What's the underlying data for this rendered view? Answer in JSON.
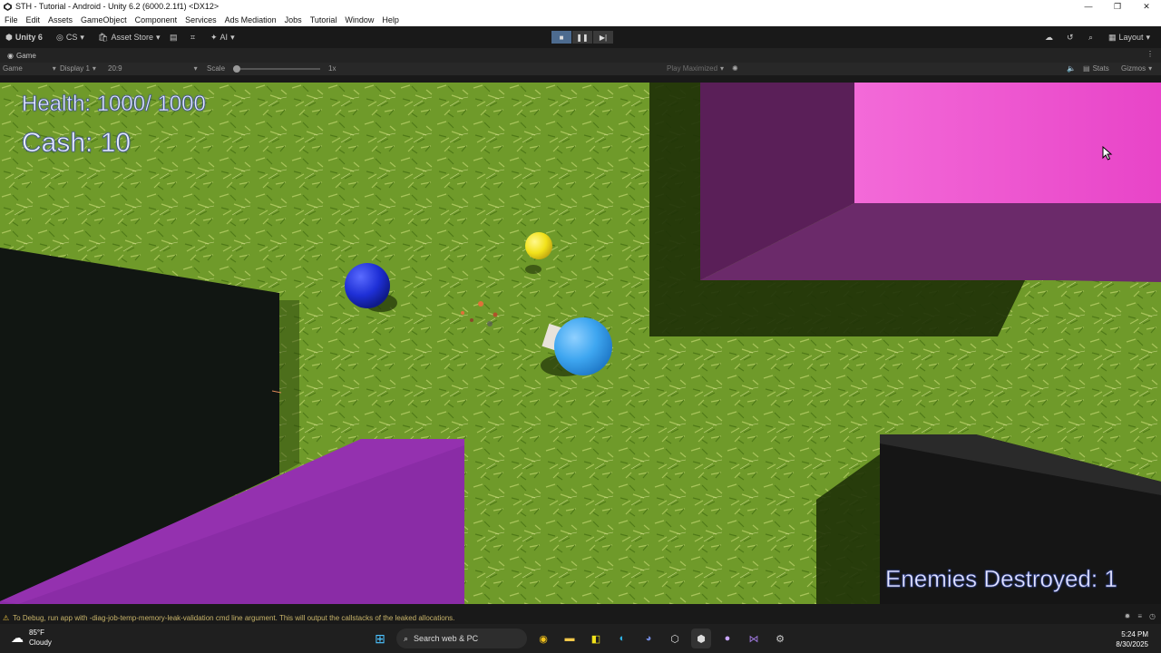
{
  "window": {
    "title": "STH - Tutorial - Android - Unity 6.2 (6000.2.1f1) <DX12>"
  },
  "menu": [
    "File",
    "Edit",
    "Assets",
    "GameObject",
    "Component",
    "Services",
    "Ads Mediation",
    "Jobs",
    "Tutorial",
    "Window",
    "Help"
  ],
  "toolbar": {
    "account": "Unity 6",
    "cs": "CS",
    "asset_store": "Asset Store",
    "ai": "AI",
    "layout": "Layout",
    "play_active_glyph": "■",
    "pause_glyph": "❚❚",
    "step_glyph": "▶|"
  },
  "tab": {
    "label": "Game"
  },
  "game_options": {
    "view": "Game",
    "display": "Display 1",
    "aspect": "20:9",
    "scale_label": "Scale",
    "scale_value": "1x",
    "play_mode": "Play Maximized",
    "stats": "Stats",
    "gizmos": "Gizmos"
  },
  "hud": {
    "health": "Health: 1000/ 1000",
    "cash": "Cash: 10",
    "enemies": "Enemies Destroyed: 1"
  },
  "console": {
    "message": "To Debug, run app with -diag-job-temp-memory-leak-validation cmd line argument. This will output the callstacks of the leaked allocations."
  },
  "taskbar": {
    "temp": "85°F",
    "condition": "Cloudy",
    "search_placeholder": "Search web & PC",
    "time": "5:24 PM",
    "date": "8/30/2025"
  },
  "colors": {
    "grass": "#6f9a2a",
    "magenta_wall": "#e64fcf",
    "purple_wall": "#8a2ca6",
    "player_ball": "#3ea6f0",
    "enemy_ball": "#1e2fd6",
    "cash_pickup": "#f2e21a"
  }
}
